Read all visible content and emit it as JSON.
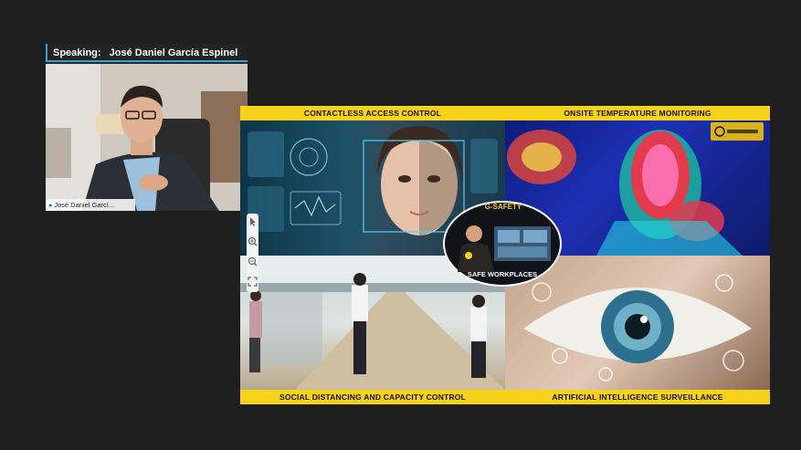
{
  "speaker": {
    "speaking_label": "Speaking:",
    "speaking_name": "José Daniel García Espinel",
    "tile_name": "José Daniel Garcí..."
  },
  "slide": {
    "top_left_label": "CONTACTLESS ACCESS CONTROL",
    "top_right_label": "ONSITE TEMPERATURE MONITORING",
    "bottom_left_label": "SOCIAL DISTANCING AND CAPACITY CONTROL",
    "bottom_right_label": "ARTIFICIAL INTELLIGENCE SURVEILLANCE",
    "badge_title": "G-SAFETY",
    "badge_subtitle": "SAFE WORKPLACES"
  },
  "colors": {
    "band": "#f6d21b",
    "accent": "#3aa0d8",
    "background": "#1f1f1f"
  },
  "icons": {
    "mic": "microphone-icon",
    "toolbar": [
      "pointer-icon",
      "zoom-in-icon",
      "zoom-out-icon",
      "fit-icon"
    ]
  }
}
